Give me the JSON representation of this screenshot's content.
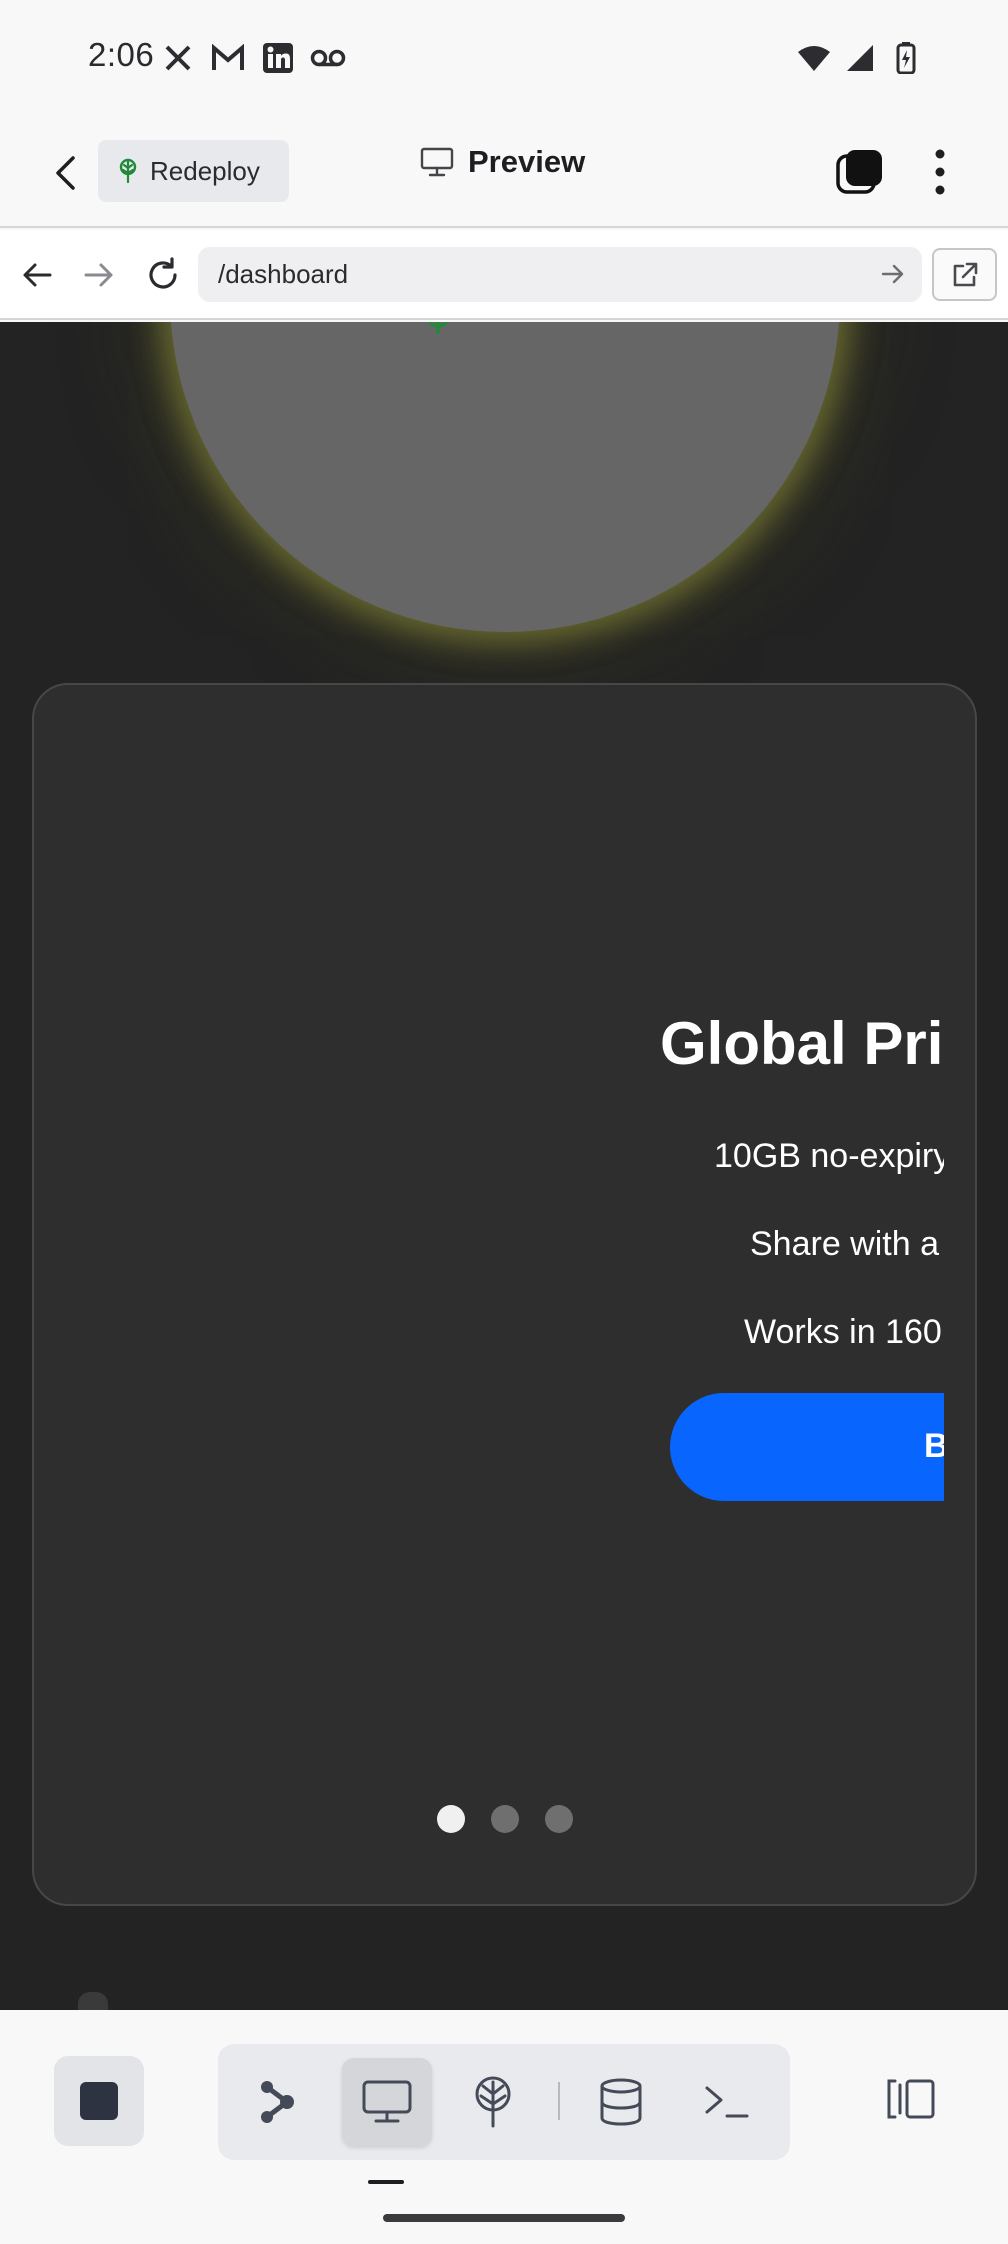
{
  "status_bar": {
    "time": "2:06",
    "left_icons": [
      "x-icon",
      "gmail-icon",
      "linkedin-icon",
      "voicemail-icon"
    ],
    "right_icons": [
      "wifi-icon",
      "signal-icon",
      "battery-charging-icon"
    ]
  },
  "header": {
    "redeploy_label": "Redeploy",
    "title": "Preview"
  },
  "url_bar": {
    "url": "/dashboard"
  },
  "promo": {
    "title": "Global Pri",
    "line_1": "10GB no-expiry",
    "line_2": "Share with a",
    "line_3": "Works in 160",
    "cta_label": "B",
    "dots": 3,
    "active_dot": 1
  },
  "bottom_bar": {
    "tools": [
      "agent-icon",
      "preview-monitor-icon",
      "deploy-icon",
      "database-icon",
      "terminal-icon"
    ],
    "selected_tool": "preview-monitor-icon"
  },
  "colors": {
    "page_bg": "#232323",
    "card_bg": "#2e2e2e",
    "cta_blue": "#0866ff",
    "glow": "#a0a040"
  }
}
